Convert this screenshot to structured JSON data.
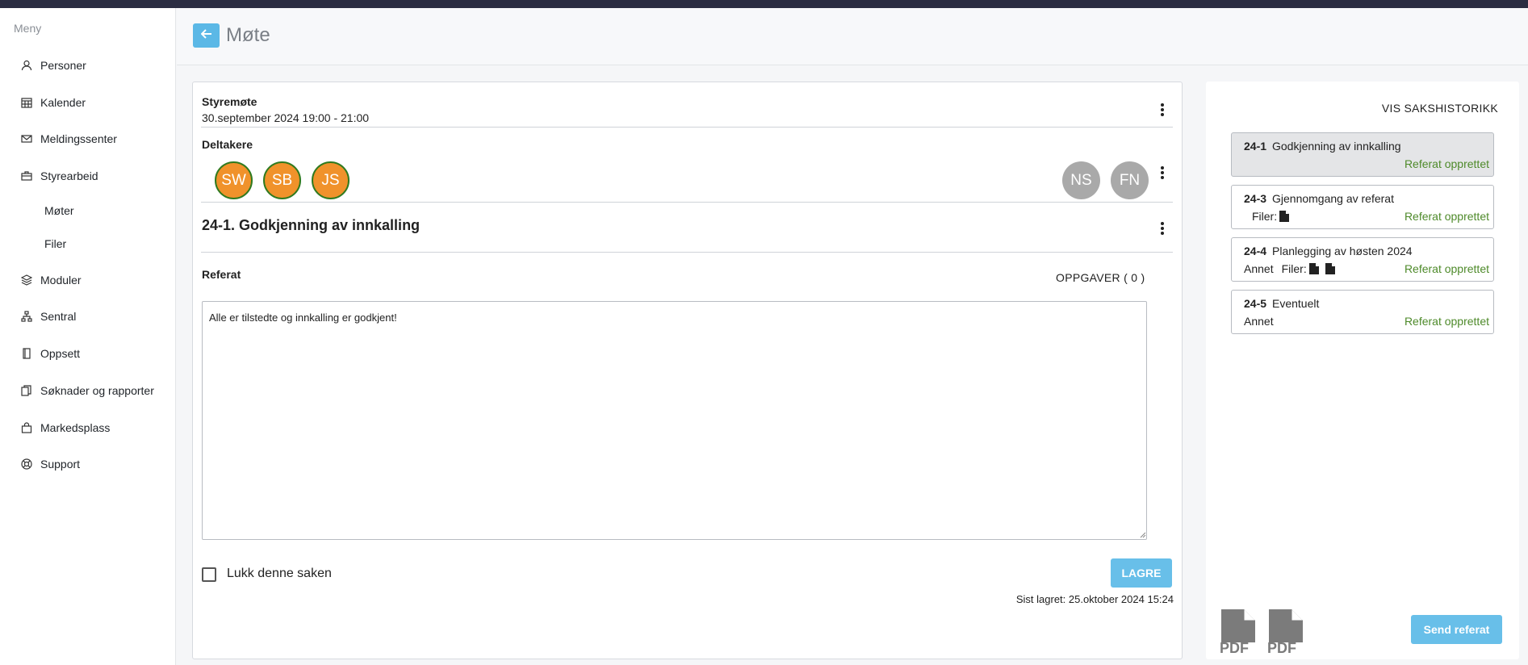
{
  "sidebar": {
    "title": "Meny",
    "items": [
      {
        "label": "Personer",
        "icon": "person-icon"
      },
      {
        "label": "Kalender",
        "icon": "calendar-icon"
      },
      {
        "label": "Meldingssenter",
        "icon": "mail-icon"
      },
      {
        "label": "Styrearbeid",
        "icon": "briefcase-icon"
      },
      {
        "label": "Moduler",
        "icon": "layers-icon"
      },
      {
        "label": "Sentral",
        "icon": "sitemap-icon"
      },
      {
        "label": "Oppsett",
        "icon": "book-icon"
      },
      {
        "label": "Søknader og rapporter",
        "icon": "documents-icon"
      },
      {
        "label": "Markedsplass",
        "icon": "shopping-bag-icon"
      },
      {
        "label": "Support",
        "icon": "lifebuoy-icon"
      }
    ],
    "subitems": [
      {
        "label": "Møter"
      },
      {
        "label": "Filer"
      }
    ]
  },
  "header": {
    "title": "Møte",
    "back_icon": "arrow-left-icon"
  },
  "meeting": {
    "name": "Styremøte",
    "time": "30.september 2024 19:00 - 21:00",
    "participants_label": "Deltakere",
    "participants": [
      {
        "initials": "SW",
        "present": true
      },
      {
        "initials": "SB",
        "present": true
      },
      {
        "initials": "JS",
        "present": true
      },
      {
        "initials": "NS",
        "present": false
      },
      {
        "initials": "FN",
        "present": false
      }
    ],
    "agenda_title": "24-1. Godkjenning av innkalling",
    "referat_label": "Referat",
    "tasks_label": "OPPGAVER ( 0 )",
    "referat_text": "Alle er tilstedte og innkalling er godkjent!",
    "close_label": "Lukk denne saken",
    "save_label": "LAGRE",
    "last_saved": "Sist lagret: 25.oktober 2024 15:24"
  },
  "panel": {
    "history_label": "VIS SAKSHISTORIKK",
    "cases": [
      {
        "number": "24-1",
        "title": "Godkjenning av innkalling",
        "sub": "",
        "files_label": "",
        "file_count": 0,
        "status": "Referat opprettet",
        "active": true
      },
      {
        "number": "24-3",
        "title": "Gjennomgang av referat",
        "sub": "",
        "files_label": "Filer:",
        "file_count": 1,
        "status": "Referat opprettet",
        "active": false
      },
      {
        "number": "24-4",
        "title": "Planlegging av høsten 2024",
        "sub": "Annet",
        "files_label": "Filer:",
        "file_count": 2,
        "status": "Referat opprettet",
        "active": false
      },
      {
        "number": "24-5",
        "title": "Eventuelt",
        "sub": "Annet",
        "files_label": "",
        "file_count": 0,
        "status": "Referat opprettet",
        "active": false
      }
    ],
    "pdf_label": "PDF",
    "send_label": "Send referat"
  },
  "colors": {
    "accent": "#5bb8e6",
    "present_avatar": "#f0922b",
    "present_border": "#2f7a1f",
    "absent_avatar": "#a9a9a9",
    "status_green": "#4e8a2a"
  }
}
